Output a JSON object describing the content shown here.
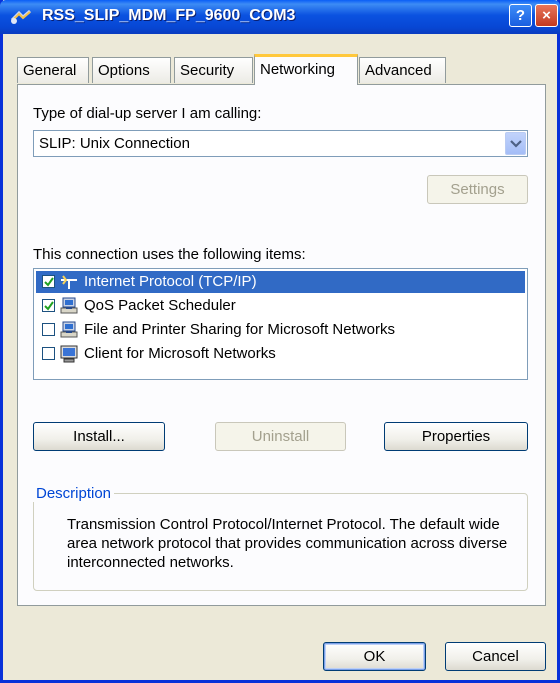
{
  "window": {
    "title": "RSS_SLIP_MDM_FP_9600_COM3",
    "help_label": "?",
    "close_label": "×"
  },
  "tabs": [
    {
      "label": "General"
    },
    {
      "label": "Options"
    },
    {
      "label": "Security"
    },
    {
      "label": "Networking"
    },
    {
      "label": "Advanced"
    }
  ],
  "active_tab": "Networking",
  "server_type": {
    "label": "Type of dial-up server I am calling:",
    "value": "SLIP: Unix Connection",
    "settings_label": "Settings"
  },
  "items_section": {
    "label": "This connection uses the following items:",
    "items": [
      {
        "label": "Internet Protocol (TCP/IP)",
        "checked": true,
        "selected": true,
        "icon": "network-protocol-icon"
      },
      {
        "label": "QoS Packet Scheduler",
        "checked": true,
        "selected": false,
        "icon": "network-service-icon"
      },
      {
        "label": "File and Printer Sharing for Microsoft Networks",
        "checked": false,
        "selected": false,
        "icon": "network-service-icon"
      },
      {
        "label": "Client for Microsoft Networks",
        "checked": false,
        "selected": false,
        "icon": "network-client-icon"
      }
    ]
  },
  "item_buttons": {
    "install": "Install...",
    "uninstall": "Uninstall",
    "properties": "Properties"
  },
  "description": {
    "title": "Description",
    "text": "Transmission Control Protocol/Internet Protocol. The default wide area network protocol that provides communication across diverse interconnected networks."
  },
  "footer": {
    "ok": "OK",
    "cancel": "Cancel"
  },
  "colors": {
    "titlebar": "#0a54e3",
    "selection": "#316ac5",
    "active_tab_accent": "#ffc83c",
    "group_title": "#0046d5"
  }
}
